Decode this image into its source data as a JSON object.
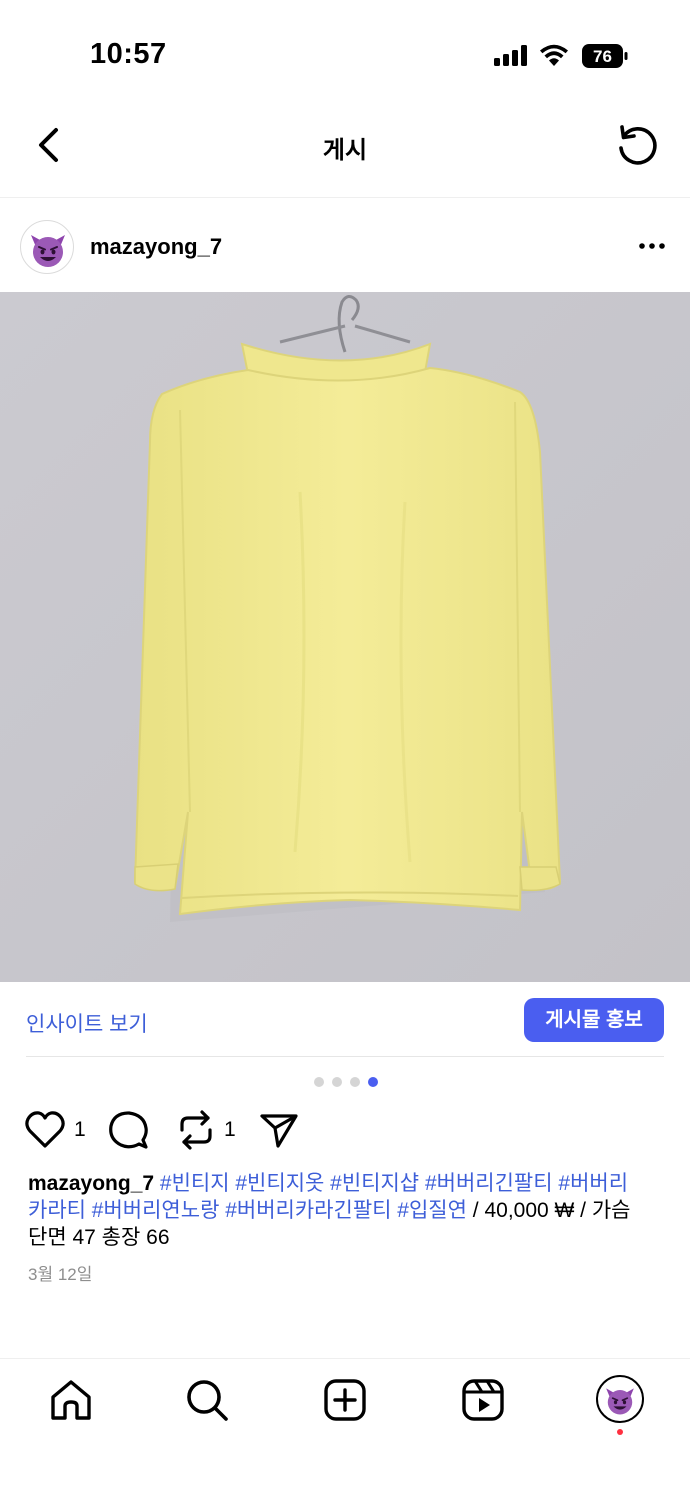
{
  "status_bar": {
    "time": "10:57",
    "battery": "76"
  },
  "nav": {
    "title": "게시"
  },
  "post": {
    "username": "mazayong_7",
    "image_alt": "yellow long-sleeve collared shirt on hanger, back view",
    "insight_link": "인사이트 보기",
    "promote_button": "게시물 홍보",
    "carousel": {
      "total": 4,
      "active_index": 3
    },
    "likes": "1",
    "reposts": "1",
    "caption": {
      "user": "mazayong_7",
      "tags_line1": "#빈티지 #빈티지옷 #빈티지샵 #버버리긴팔티 #버버리",
      "tags_line2": "카라티 #버버리연노랑 #버버리카라긴팔티 #입질연",
      "price_text": " / 40,000 ₩ / 가슴",
      "size_text": "단면 47 총장 66"
    },
    "date": "3월 12일"
  },
  "colors": {
    "accent": "#4a5ef0",
    "link": "#3d5ed8",
    "shirt": "#f2ea8e",
    "notification": "#ff3040"
  },
  "tab_bar": [
    "home-icon",
    "search-icon",
    "create-icon",
    "reels-icon",
    "profile-avatar"
  ]
}
